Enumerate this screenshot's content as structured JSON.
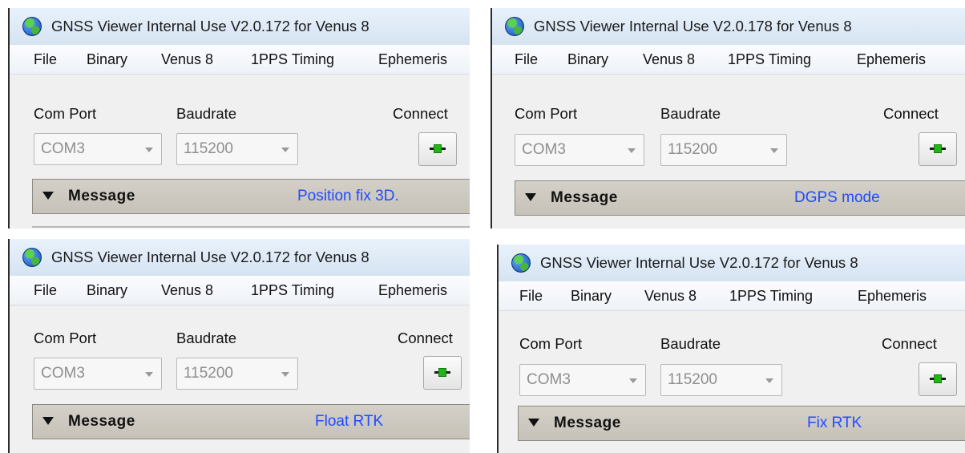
{
  "panels": [
    {
      "title": "GNSS Viewer Internal Use V2.0.172 for Venus 8",
      "menu": [
        "File",
        "Binary",
        "Venus 8",
        "1PPS Timing",
        "Ephemeris"
      ],
      "com_port_label": "Com Port",
      "baudrate_label": "Baudrate",
      "connect_label": "Connect",
      "com_port_value": "COM3",
      "baudrate_value": "115200",
      "message_label": "Message",
      "status": "Position fix 3D."
    },
    {
      "title": "GNSS Viewer Internal Use V2.0.178 for Venus 8",
      "menu": [
        "File",
        "Binary",
        "Venus 8",
        "1PPS Timing",
        "Ephemeris"
      ],
      "com_port_label": "Com Port",
      "baudrate_label": "Baudrate",
      "connect_label": "Connect",
      "com_port_value": "COM3",
      "baudrate_value": "115200",
      "message_label": "Message",
      "status": "DGPS mode"
    },
    {
      "title": "GNSS Viewer Internal Use V2.0.172 for Venus 8",
      "menu": [
        "File",
        "Binary",
        "Venus 8",
        "1PPS Timing",
        "Ephemeris"
      ],
      "com_port_label": "Com Port",
      "baudrate_label": "Baudrate",
      "connect_label": "Connect",
      "com_port_value": "COM3",
      "baudrate_value": "115200",
      "message_label": "Message",
      "status": "Float RTK"
    },
    {
      "title": "GNSS Viewer Internal Use V2.0.172 for Venus 8",
      "menu": [
        "File",
        "Binary",
        "Venus 8",
        "1PPS Timing",
        "Ephemeris"
      ],
      "com_port_label": "Com Port",
      "baudrate_label": "Baudrate",
      "connect_label": "Connect",
      "com_port_value": "COM3",
      "baudrate_value": "115200",
      "message_label": "Message",
      "status": "Fix RTK"
    }
  ]
}
